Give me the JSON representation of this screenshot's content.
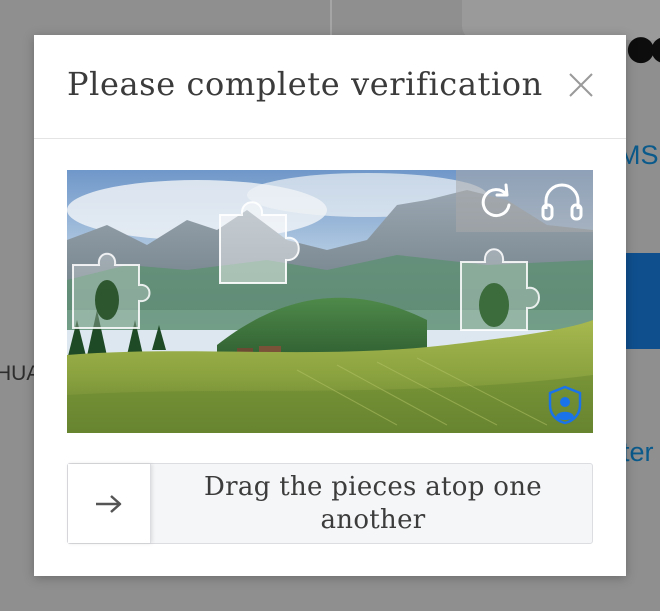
{
  "background": {
    "link_1_fragment": "MS",
    "text_fragment": "HUA",
    "link_2_fragment": "ter"
  },
  "modal": {
    "title": "Please complete verification",
    "close_icon": "close-icon"
  },
  "puzzle": {
    "scene": "mountain meadow landscape",
    "controls": {
      "refresh_icon": "refresh-icon",
      "audio_icon": "headphones-icon"
    },
    "badge_icon": "shield-user-icon"
  },
  "slider": {
    "handle_icon": "arrow-right-icon",
    "instruction": "Drag the pieces atop one another"
  },
  "colors": {
    "accent_blue": "#1a73e8",
    "overlay": "#8c8c8c",
    "title_text": "#3b3b3b"
  }
}
